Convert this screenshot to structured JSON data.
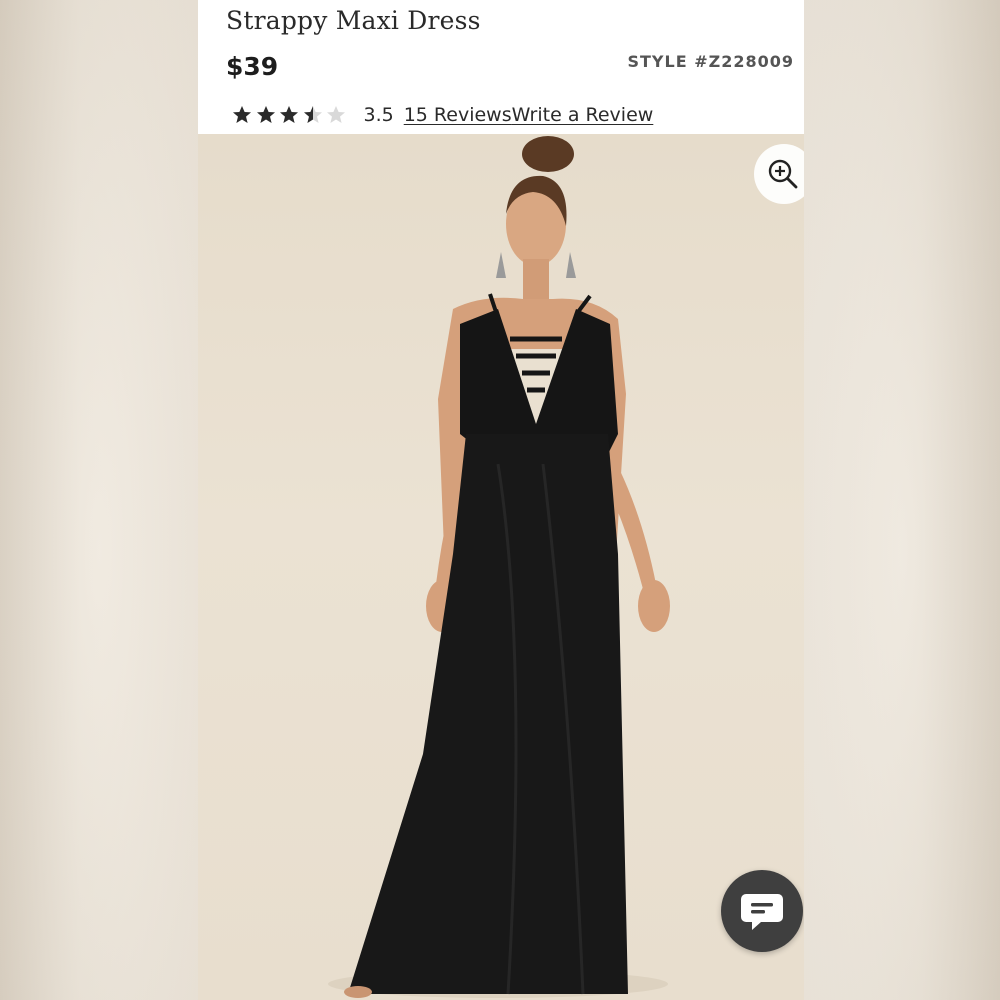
{
  "product": {
    "title": "Strappy Maxi Dress",
    "price": "$39",
    "style_number": "STYLE #Z228009"
  },
  "rating": {
    "value": "3.5",
    "stars_filled": 3.5,
    "stars_total": 5,
    "reviews_link": "15 Reviews",
    "write_review_link": "Write a Review"
  },
  "image": {
    "description_icon": "zoom-in-icon",
    "chat_icon": "chat-bubble-icon"
  },
  "colors": {
    "star_fill": "#2b2b2b",
    "star_empty": "#d9d9d9",
    "chat_button": "#3f3f3f",
    "background": "#e9dfcf"
  }
}
